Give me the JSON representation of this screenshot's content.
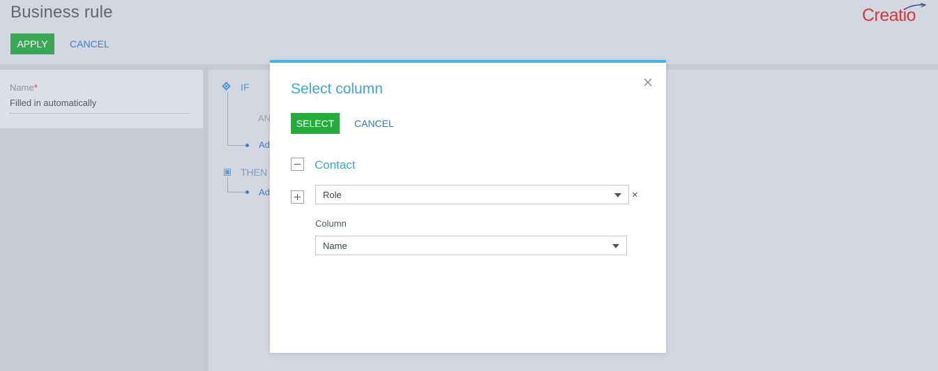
{
  "header": {
    "title": "Business rule",
    "apply_label": "APPLY",
    "cancel_label": "CANCEL",
    "logo_text": "Creatio"
  },
  "left_panel": {
    "name_label": "Name",
    "required_mark": "*",
    "name_value": "Filled in automatically"
  },
  "rules": {
    "if_label": "IF",
    "and_label": "AN",
    "add_condition_label": "Ad",
    "then_label": "THEN",
    "add_action_label": "Ad"
  },
  "modal": {
    "title": "Select column",
    "select_label": "SELECT",
    "cancel_label": "CANCEL",
    "root_node": "Contact",
    "role_select_value": "Role",
    "clear_symbol": "×",
    "column_label": "Column",
    "column_select_value": "Name"
  },
  "colors": {
    "apply_button": "#3aa854",
    "select_button": "#22ad3b",
    "modal_accent": "#3db5e6",
    "link_blue": "#3d7dca",
    "logo_red": "#d23a3a"
  }
}
